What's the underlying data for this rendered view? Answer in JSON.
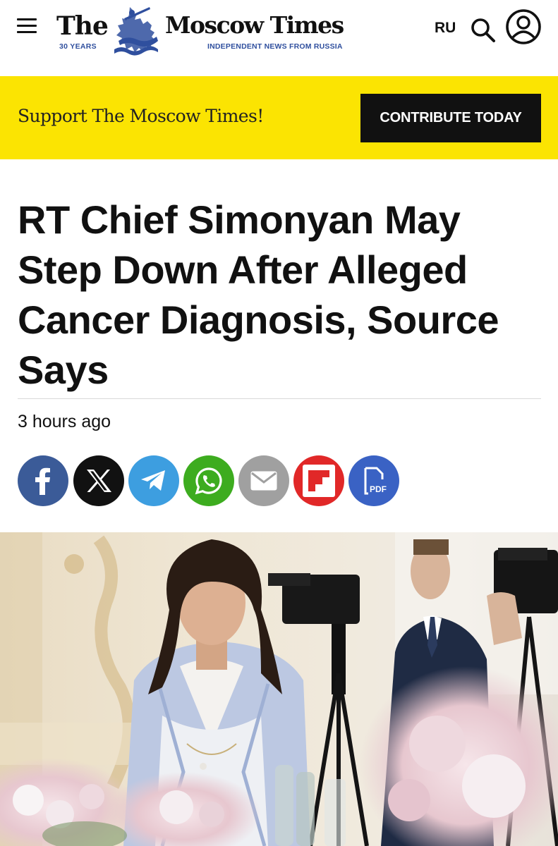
{
  "header": {
    "logo": {
      "the": "The",
      "name": "Moscow Times",
      "years": "30 YEARS",
      "tagline": "INDEPENDENT NEWS FROM RUSSIA"
    },
    "lang_label": "RU",
    "icons": [
      "menu-icon",
      "search-icon",
      "account-icon"
    ]
  },
  "banner": {
    "text": "Support The Moscow Times!",
    "button_label": "CONTRIBUTE TODAY",
    "background": "#fbe402"
  },
  "article": {
    "headline": "RT Chief Simonyan May Step Down After Alleged Cancer Diagnosis, Source Says",
    "time": "3 hours ago",
    "share_buttons": [
      {
        "name": "facebook",
        "color": "#3b5b98"
      },
      {
        "name": "x",
        "color": "#111111"
      },
      {
        "name": "telegram",
        "color": "#3d9ee0"
      },
      {
        "name": "whatsapp",
        "color": "#3dac1f"
      },
      {
        "name": "email",
        "color": "#a0a0a0"
      },
      {
        "name": "flipboard",
        "color": "#e12828"
      },
      {
        "name": "pdf",
        "color": "#3a62c4",
        "label": "PDF"
      }
    ]
  },
  "colors": {
    "brand_blue": "#2f4f9e",
    "banner_yellow": "#fbe402",
    "button_black": "#111111"
  }
}
